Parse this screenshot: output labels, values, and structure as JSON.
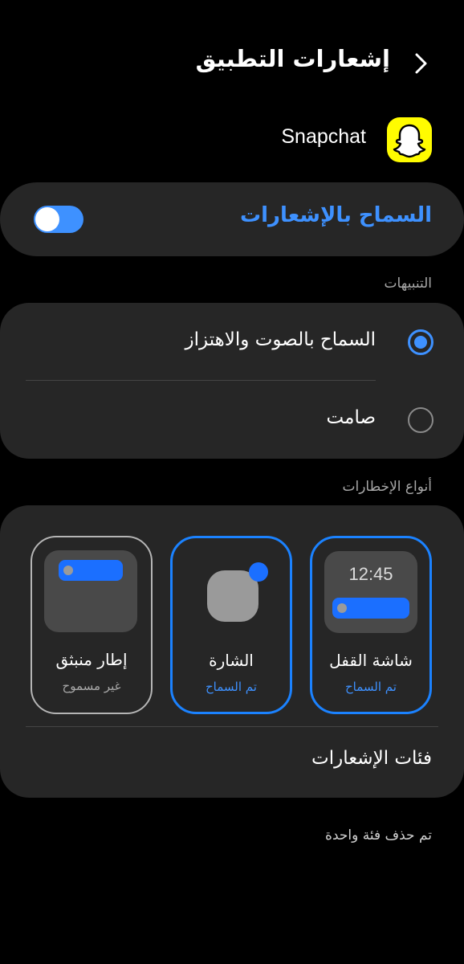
{
  "header": {
    "title": "إشعارات التطبيق",
    "back_icon": "chevron-back-icon"
  },
  "app": {
    "name": "Snapchat",
    "icon": "snapchat-ghost-icon",
    "icon_color": "#FFFC00"
  },
  "allow_notifications": {
    "label": "السماح بالإشعارات",
    "enabled": false,
    "accent": "#3E91FF"
  },
  "alerts": {
    "section_label": "التنبيهات",
    "options": [
      {
        "label": "السماح بالصوت والاهتزاز",
        "selected": true
      },
      {
        "label": "صامت",
        "selected": false
      }
    ]
  },
  "alert_types": {
    "section_label": "أنواع الإخطارات",
    "tiles": [
      {
        "name": "شاشة القفل",
        "status": "تم السماح",
        "allowed": true,
        "preview_time": "12:45"
      },
      {
        "name": "الشارة",
        "status": "تم السماح",
        "allowed": true
      },
      {
        "name": "إطار منبثق",
        "status": "غير مسموح",
        "allowed": false
      }
    ],
    "categories_label": "فئات الإشعارات"
  },
  "footer_note": "تم حذف فئة واحدة",
  "colors": {
    "background": "#000000",
    "card": "#262626",
    "accent": "#3E91FF",
    "tile_border_on": "#1B82FF"
  }
}
